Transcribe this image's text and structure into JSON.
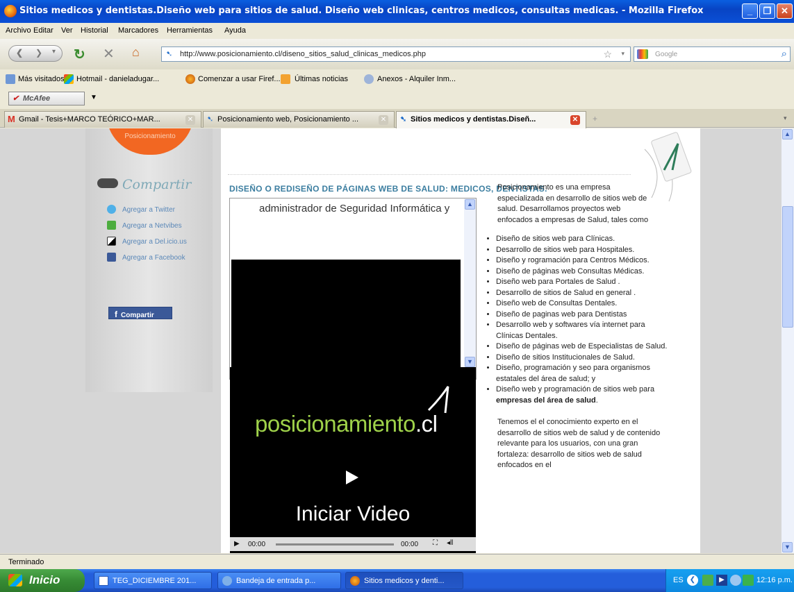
{
  "window": {
    "title": "Sitios medicos y dentistas.Diseño web para sitios de salud. Diseño web clinicas, centros medicos, consultas medicas. - Mozilla Firefox"
  },
  "menu": [
    "Archivo",
    "Editar",
    "Ver",
    "Historial",
    "Marcadores",
    "Herramientas",
    "Ayuda"
  ],
  "nav": {
    "url": "http://www.posicionamiento.cl/diseno_sitios_salud_clinicas_medicos.php",
    "search_placeholder": "Google"
  },
  "bookmarks": [
    "Más visitados",
    "Hotmail - danieladugar...",
    "Comenzar a usar Firef...",
    "Últimas noticias",
    "Anexos - Alquiler Inm..."
  ],
  "addon": {
    "mcafee": "McAfee"
  },
  "tabs": [
    {
      "label": "Gmail - Tesis+MARCO TEÓRICO+MAR..."
    },
    {
      "label": "Posicionamiento web, Posicionamiento ..."
    },
    {
      "label": "Sitios medicos y dentistas.Diseñ...",
      "active": true
    }
  ],
  "page": {
    "badge": "Posicionamiento",
    "share_title": "Compartir",
    "share_items": [
      "Agregar a Twitter",
      "Agregar a Netvibes",
      "Agregar a Del.icio.us",
      "Agregar a Facebook"
    ],
    "fb_button": "Compartir",
    "heading": "DISEÑO O REDISEÑO DE PÁGINAS WEB DE SALUD: MEDICOS, DENTISTAS.",
    "iframe_text": "administrador de Seguridad Informática y",
    "video": {
      "logo_main": "posicionamiento",
      "logo_tld": ".cl",
      "cta": "Iniciar Video",
      "time_left": "00:00",
      "time_right": "00:00"
    },
    "intro": "Posicionamiento es una empresa especializada en desarrollo de sitios web de salud. Desarrollamos proyectos web enfocados a empresas de Salud, tales como",
    "services": [
      "Diseño de sitios web para Clínicas.",
      "Desarrollo de sitios web para Hospitales.",
      "Diseño y rogramación para Centros Médicos.",
      "Diseño de páginas web Consultas Médicas.",
      "Diseño web para Portales de Salud .",
      "Desarrollo de sitios de Salud en general .",
      "Diseño web de Consultas Dentales.",
      "Diseño de paginas web para Dentistas",
      "Desarrollo web y softwares vía internet para Clínicas Dentales.",
      "Diseño de páginas web de Especialistas de Salud.",
      "Diseño de sitios Institucionales de Salud.",
      "Diseño, programación y seo para organismos estatales del área de salud; y",
      "Diseño web y programación de sitios web para"
    ],
    "services_bold": "empresas del área de salud",
    "outro": "Tenemos el el conocimiento experto en el desarrollo de sitios web de salud y de contenido relevante para los usuarios, con una gran fortaleza: desarrollo de sitios web de salud enfocados en el"
  },
  "status": "Terminado",
  "taskbar": {
    "start": "Inicio",
    "tasks": [
      "TEG_DICIEMBRE 201...",
      "Bandeja de entrada p...",
      "Sitios medicos y denti..."
    ],
    "lang": "ES",
    "clock": "12:16 p.m."
  }
}
